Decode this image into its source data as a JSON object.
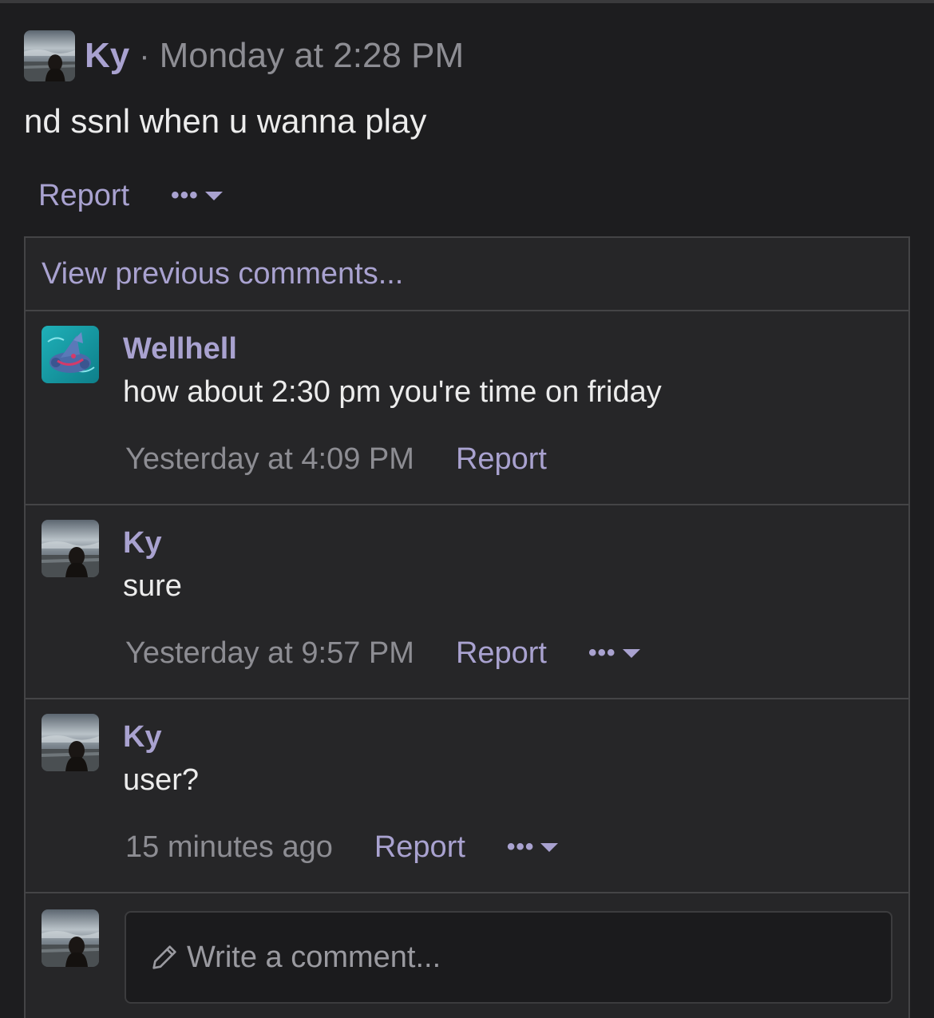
{
  "post": {
    "author": "Ky",
    "separator": "·",
    "time": "Monday at 2:28 PM",
    "body": "nd ssnl when u wanna play",
    "report_label": "Report",
    "more_label": "•••"
  },
  "comments": {
    "view_previous": "View previous comments...",
    "items": [
      {
        "author": "Wellhell",
        "text": "how about 2:30 pm you're time on friday",
        "time": "Yesterday at 4:09 PM",
        "report_label": "Report",
        "avatar": "pokemon-avatar"
      },
      {
        "author": "Ky",
        "text": "sure",
        "time": "Yesterday at 9:57 PM",
        "report_label": "Report",
        "more_label": "•••",
        "avatar": "beach-photo-avatar"
      },
      {
        "author": "Ky",
        "text": "user?",
        "time": "15 minutes ago",
        "report_label": "Report",
        "more_label": "•••",
        "avatar": "beach-photo-avatar"
      }
    ],
    "compose": {
      "placeholder": "Write a comment..."
    }
  },
  "colors": {
    "background": "#1d1d1f",
    "panel": "#262628",
    "accent": "#a9a2d0",
    "muted": "#8d8d93",
    "text": "#ececec"
  }
}
